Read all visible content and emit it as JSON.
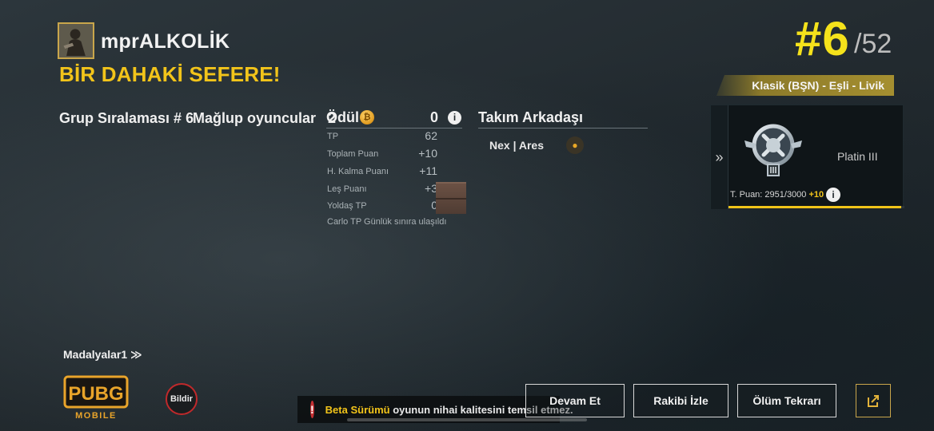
{
  "player": {
    "name": "mprALKOLİK",
    "result_message": "BİR DAHAKİ SEFERE!"
  },
  "placement": {
    "rank": "#6",
    "total": "/52"
  },
  "mode": {
    "label": "Klasik (BŞN) - Eşli - Livik"
  },
  "group_stats": {
    "group_rank": "Grup Sıralaması # 6",
    "defeated_label": "Mağlup oyuncular",
    "defeated_value": "2"
  },
  "reward": {
    "title": "Ödül",
    "coin_glyph": "₿",
    "value": "0",
    "rows": [
      {
        "label": "TP",
        "value": "62"
      },
      {
        "label": "Toplam Puan",
        "value": "+10"
      },
      {
        "label": "H. Kalma Puanı",
        "value": "+11"
      },
      {
        "label": "Leş Puanı",
        "value": "+3"
      },
      {
        "label": "Yoldaş TP",
        "value": "0"
      }
    ],
    "note": "Carlo TP Günlük sınıra ulaşıldı"
  },
  "teammate": {
    "title": "Takım Arkadaşı",
    "name": "Nex | Ares"
  },
  "rank_panel": {
    "tier": "Platin III",
    "points_text": "T. Puan: 2951/3000",
    "points_gain": "+10",
    "progress": 0.9837,
    "accent_color": "#f0c419"
  },
  "medals": {
    "label": "Madalyalar1 ≫"
  },
  "logo": {
    "line1": "PUBG",
    "line2": "MOBILE"
  },
  "report": {
    "label": "Bildir"
  },
  "beta_notice": {
    "highlight": "Beta Sürümü",
    "text": " oyunun nihai kalitesini temsil etmez."
  },
  "buttons": {
    "continue": "Devam Et",
    "spectate": "Rakibi İzle",
    "replay": "Ölüm Tekrarı"
  },
  "icons": {
    "info": "i",
    "panel_arrow": "»",
    "beta": "!"
  },
  "colors": {
    "yellow_accent": "#f2c41a",
    "rank_yellow": "#f5e21b",
    "danger_red": "#c63033"
  }
}
